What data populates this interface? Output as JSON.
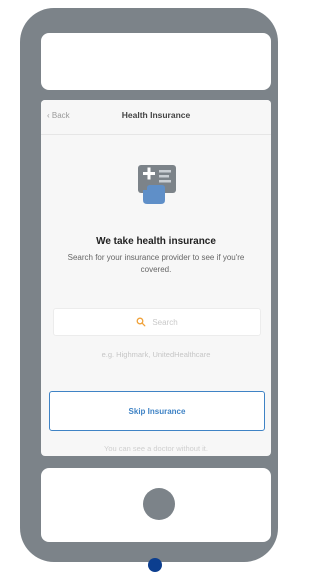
{
  "nav": {
    "back_label": "‹ Back",
    "title": "Health Insurance"
  },
  "hero": {
    "icon": "insurance-card-icon",
    "headline": "We take health insurance",
    "subtext": "Search for your insurance provider to see if you're covered."
  },
  "search": {
    "icon": "search-icon",
    "placeholder": "Search",
    "example": "e.g. Highmark, UnitedHealthcare"
  },
  "skip": {
    "label": "Skip Insurance",
    "note": "You can see a doctor without it."
  },
  "colors": {
    "phone_frame": "#7c8389",
    "accent": "#3f83c5",
    "search_accent": "#f0a23a",
    "indicator_dot": "#0c3e8f"
  }
}
